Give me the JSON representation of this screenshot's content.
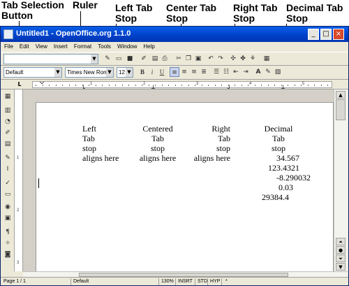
{
  "callouts": {
    "tab_selection": "Tab Selection\nButton",
    "ruler": "Ruler",
    "left_tab": "Left Tab\nStop",
    "center_tab": "Center Tab\nStop",
    "right_tab": "Right Tab\nStop",
    "decimal_tab": "Decimal Tab\nStop"
  },
  "window": {
    "title": "Untitled1 - OpenOffice.org 1.1.0",
    "buttons": {
      "minimize": "_",
      "maximize": "□",
      "close": "×"
    }
  },
  "menu": [
    "File",
    "Edit",
    "View",
    "Insert",
    "Format",
    "Tools",
    "Window",
    "Help"
  ],
  "toolbar": {
    "style": "Default",
    "font": "Times New Roman",
    "size": "12",
    "bold": "B",
    "italic": "i",
    "underline": "U"
  },
  "ruler": {
    "numbers": [
      "1",
      "2",
      "3",
      "4",
      "5"
    ],
    "tab_selector_glyph": "L"
  },
  "vruler": {
    "numbers": [
      "1",
      "2",
      "3"
    ]
  },
  "document": {
    "columns": [
      [
        "Left",
        "Tab",
        "stop",
        "aligns here"
      ],
      [
        "Centered",
        "Tab",
        "stop",
        "aligns here"
      ],
      [
        "Right",
        "Tab",
        "stop",
        "aligns here"
      ],
      [
        "Decimal",
        "Tab",
        "stop"
      ]
    ],
    "decimals": [
      "34.567",
      "123.4321",
      "-8.290032",
      "0.03",
      "29384.4"
    ]
  },
  "status": {
    "page": "Page 1 / 1",
    "style": "Default",
    "zoom": "130%",
    "insert": "INSRT",
    "std": "STD",
    "hyp": "HYP",
    "modified": "*"
  },
  "colors": {
    "titlebar": "#0040c8",
    "workspace": "#ece9d8"
  }
}
